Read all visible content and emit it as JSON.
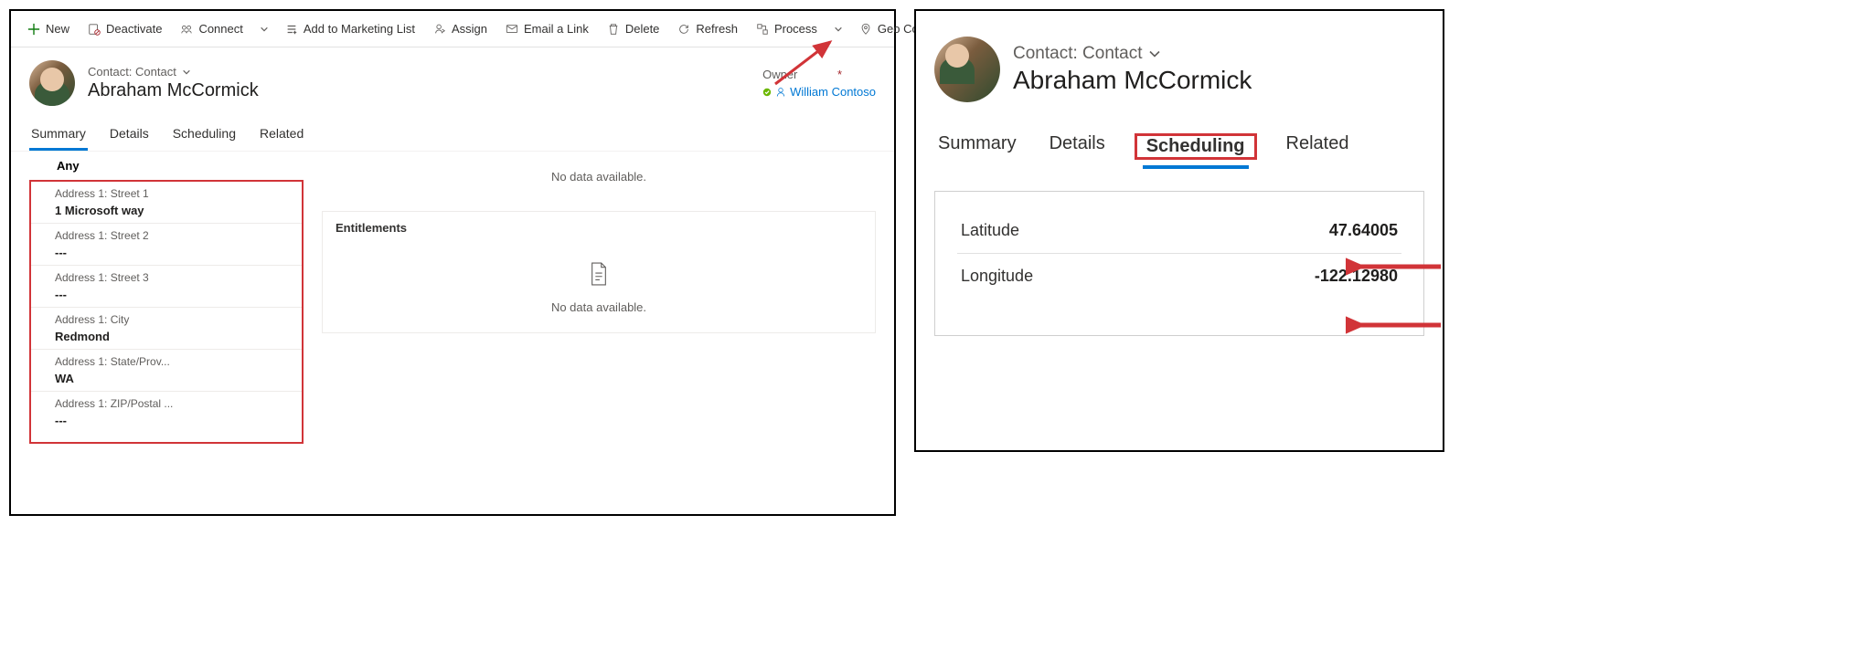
{
  "commands": {
    "new": "New",
    "deactivate": "Deactivate",
    "connect": "Connect",
    "addToMarketing": "Add to Marketing List",
    "assign": "Assign",
    "emailLink": "Email a Link",
    "delete": "Delete",
    "refresh": "Refresh",
    "process": "Process",
    "geoCode": "Geo Code"
  },
  "header": {
    "entityLine": "Contact: Contact",
    "recordName": "Abraham McCormick",
    "ownerLabel": "Owner",
    "ownerValue": "William Contoso",
    "requiredMark": "*"
  },
  "tabs": {
    "summary": "Summary",
    "details": "Details",
    "scheduling": "Scheduling",
    "related": "Related"
  },
  "form": {
    "anyHeader": "Any",
    "street1Label": "Address 1: Street 1",
    "street1Value": "1 Microsoft way",
    "street2Label": "Address 1: Street 2",
    "street2Value": "---",
    "street3Label": "Address 1: Street 3",
    "street3Value": "---",
    "cityLabel": "Address 1: City",
    "cityValue": "Redmond",
    "stateLabel": "Address 1: State/Prov...",
    "stateValue": "WA",
    "zipLabel": "Address 1: ZIP/Postal ...",
    "zipValue": "---"
  },
  "right": {
    "noData": "No data available.",
    "entitlements": "Entitlements"
  },
  "scheduling": {
    "latLabel": "Latitude",
    "latValue": "47.64005",
    "lonLabel": "Longitude",
    "lonValue": "-122.12980"
  }
}
